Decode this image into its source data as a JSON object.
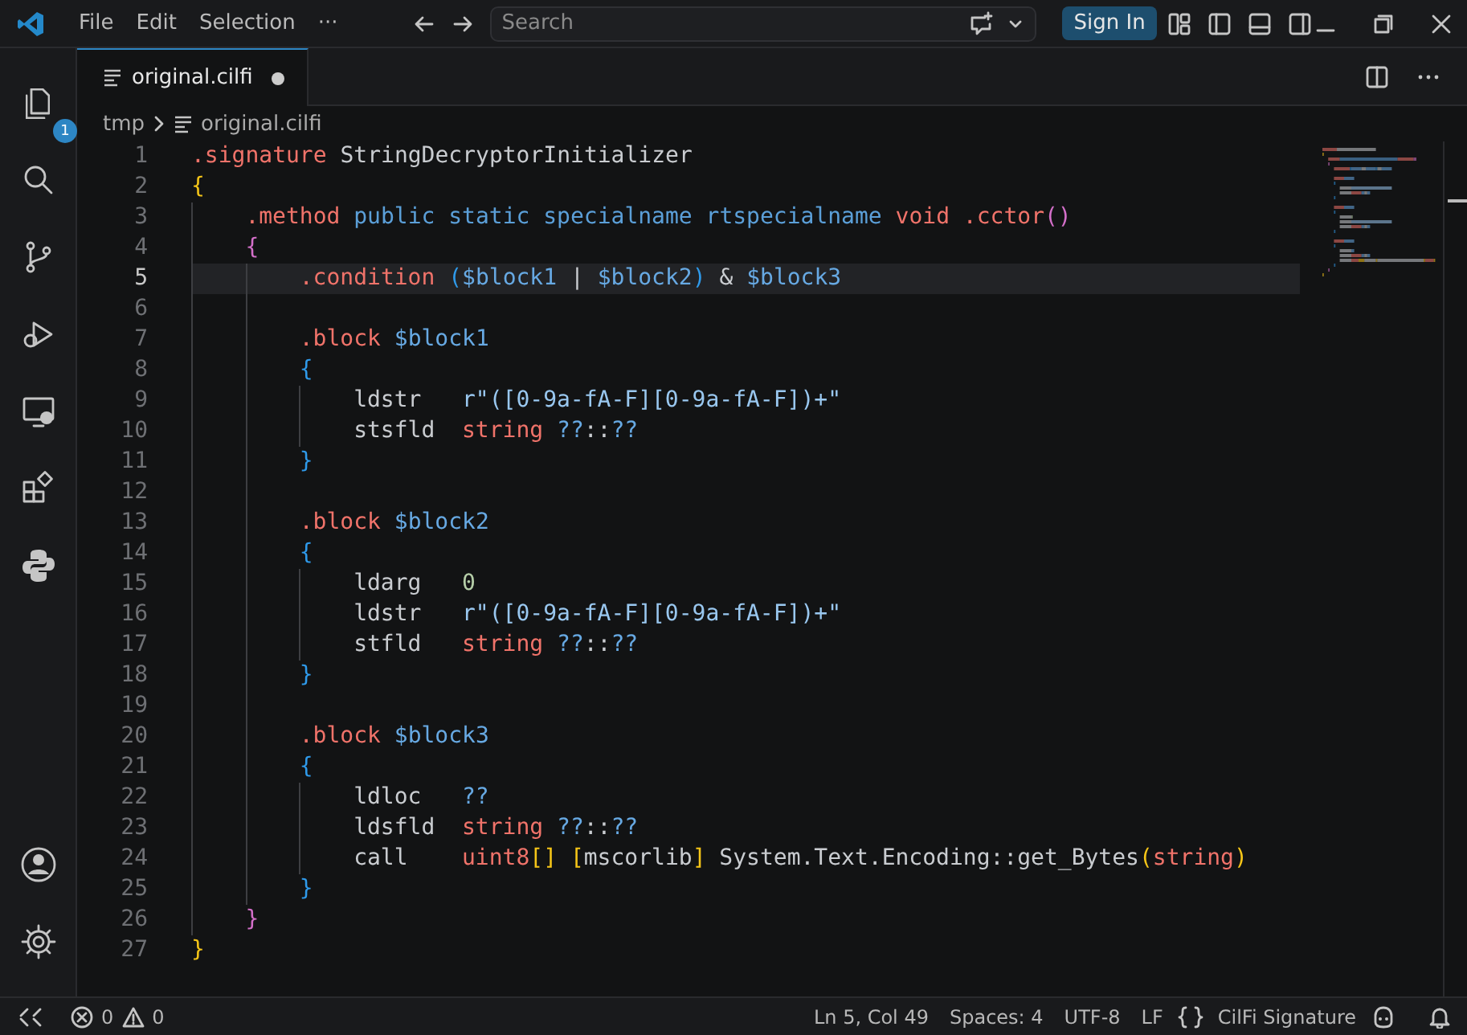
{
  "title_bar": {
    "menu": [
      "File",
      "Edit",
      "Selection",
      "···"
    ],
    "search": {
      "placeholder": "Search"
    },
    "sign_in": "Sign In"
  },
  "activity_bar": {
    "items": [
      {
        "kind": "files",
        "badge": "1"
      },
      {
        "kind": "search"
      },
      {
        "kind": "branch"
      },
      {
        "kind": "debug"
      },
      {
        "kind": "remote"
      },
      {
        "kind": "extensions"
      },
      {
        "kind": "python"
      }
    ],
    "bottom": [
      {
        "kind": "account"
      },
      {
        "kind": "settings"
      }
    ]
  },
  "tabs": [
    {
      "label": "original.cilfi",
      "modified": true,
      "selected": true
    }
  ],
  "breadcrumb": [
    "tmp",
    "original.cilfi"
  ],
  "editor": {
    "lines": [
      {
        "number": "1",
        "tokens": [
          {
            "kind": "directive",
            "text": ".signature"
          },
          {
            "kind": "plain",
            "text": " StringDecryptorInitializer"
          }
        ]
      },
      {
        "number": "2",
        "tokens": [
          {
            "kind": "bracket1",
            "text": "{"
          }
        ]
      },
      {
        "number": "3",
        "tokens": [
          {
            "kind": "directive",
            "text": "    .method "
          },
          {
            "kind": "keyword",
            "text": "public static specialname rtspecialname "
          },
          {
            "kind": "directive",
            "text": "void .cctor"
          },
          {
            "kind": "bracket2",
            "text": "()"
          }
        ]
      },
      {
        "number": "4",
        "tokens": [
          {
            "kind": "bracket2",
            "text": "    {"
          }
        ]
      },
      {
        "number": "5",
        "current": true,
        "tokens": [
          {
            "kind": "directive",
            "text": "        .condition "
          },
          {
            "kind": "bracket3",
            "text": "("
          },
          {
            "kind": "variable",
            "text": "$block1"
          },
          {
            "kind": "plain",
            "text": " | "
          },
          {
            "kind": "variable",
            "text": "$block2"
          },
          {
            "kind": "bracket3",
            "text": ")"
          },
          {
            "kind": "plain",
            "text": " & "
          },
          {
            "kind": "variable",
            "text": "$block3"
          }
        ]
      },
      {
        "number": "6"
      },
      {
        "number": "7",
        "tokens": [
          {
            "kind": "directive",
            "text": "        .block "
          },
          {
            "kind": "variable",
            "text": "$block1"
          }
        ]
      },
      {
        "number": "8",
        "tokens": [
          {
            "kind": "bracket3",
            "text": "        {"
          }
        ]
      },
      {
        "number": "9",
        "tokens": [
          {
            "kind": "plain",
            "text": "            ldstr   "
          },
          {
            "kind": "string",
            "text": "r\"([0-9a-fA-F][0-9a-fA-F])+\""
          }
        ]
      },
      {
        "number": "10",
        "tokens": [
          {
            "kind": "plain",
            "text": "            stsfld  "
          },
          {
            "kind": "type",
            "text": "string "
          },
          {
            "kind": "variable",
            "text": "??"
          },
          {
            "kind": "plain",
            "text": "::"
          },
          {
            "kind": "variable",
            "text": "??"
          }
        ]
      },
      {
        "number": "11",
        "tokens": [
          {
            "kind": "bracket3",
            "text": "        }"
          }
        ]
      },
      {
        "number": "12"
      },
      {
        "number": "13",
        "tokens": [
          {
            "kind": "directive",
            "text": "        .block "
          },
          {
            "kind": "variable",
            "text": "$block2"
          }
        ]
      },
      {
        "number": "14",
        "tokens": [
          {
            "kind": "bracket3",
            "text": "        {"
          }
        ]
      },
      {
        "number": "15",
        "tokens": [
          {
            "kind": "plain",
            "text": "            ldarg   "
          },
          {
            "kind": "number",
            "text": "0"
          }
        ]
      },
      {
        "number": "16",
        "tokens": [
          {
            "kind": "plain",
            "text": "            ldstr   "
          },
          {
            "kind": "string",
            "text": "r\"([0-9a-fA-F][0-9a-fA-F])+\""
          }
        ]
      },
      {
        "number": "17",
        "tokens": [
          {
            "kind": "plain",
            "text": "            stfld   "
          },
          {
            "kind": "type",
            "text": "string "
          },
          {
            "kind": "variable",
            "text": "??"
          },
          {
            "kind": "plain",
            "text": "::"
          },
          {
            "kind": "variable",
            "text": "??"
          }
        ]
      },
      {
        "number": "18",
        "tokens": [
          {
            "kind": "bracket3",
            "text": "        }"
          }
        ]
      },
      {
        "number": "19"
      },
      {
        "number": "20",
        "tokens": [
          {
            "kind": "directive",
            "text": "        .block "
          },
          {
            "kind": "variable",
            "text": "$block3"
          }
        ]
      },
      {
        "number": "21",
        "tokens": [
          {
            "kind": "bracket3",
            "text": "        {"
          }
        ]
      },
      {
        "number": "22",
        "tokens": [
          {
            "kind": "plain",
            "text": "            ldloc   "
          },
          {
            "kind": "variable",
            "text": "??"
          }
        ]
      },
      {
        "number": "23",
        "tokens": [
          {
            "kind": "plain",
            "text": "            ldsfld  "
          },
          {
            "kind": "type",
            "text": "string "
          },
          {
            "kind": "variable",
            "text": "??"
          },
          {
            "kind": "plain",
            "text": "::"
          },
          {
            "kind": "variable",
            "text": "??"
          }
        ]
      },
      {
        "number": "24",
        "tokens": [
          {
            "kind": "plain",
            "text": "            call    "
          },
          {
            "kind": "type",
            "text": "uint8"
          },
          {
            "kind": "bracket1",
            "text": "[] ["
          },
          {
            "kind": "plain",
            "text": "mscorlib"
          },
          {
            "kind": "bracket1",
            "text": "]"
          },
          {
            "kind": "plain",
            "text": " System.Text.Encoding::get_Bytes"
          },
          {
            "kind": "bracket1",
            "text": "("
          },
          {
            "kind": "type",
            "text": "string"
          },
          {
            "kind": "bracket1",
            "text": ")"
          }
        ]
      },
      {
        "number": "25",
        "tokens": [
          {
            "kind": "bracket3",
            "text": "        }"
          }
        ]
      },
      {
        "number": "26",
        "tokens": [
          {
            "kind": "bracket2",
            "text": "    }"
          }
        ]
      },
      {
        "number": "27",
        "tokens": [
          {
            "kind": "bracket1",
            "text": "}"
          }
        ]
      }
    ]
  },
  "status_bar": {
    "errors": "0",
    "warnings": "0",
    "items": [
      "Ln 5, Col 49",
      "Spaces: 4",
      "UTF-8",
      "LF"
    ],
    "language": "CilFi Signature"
  }
}
